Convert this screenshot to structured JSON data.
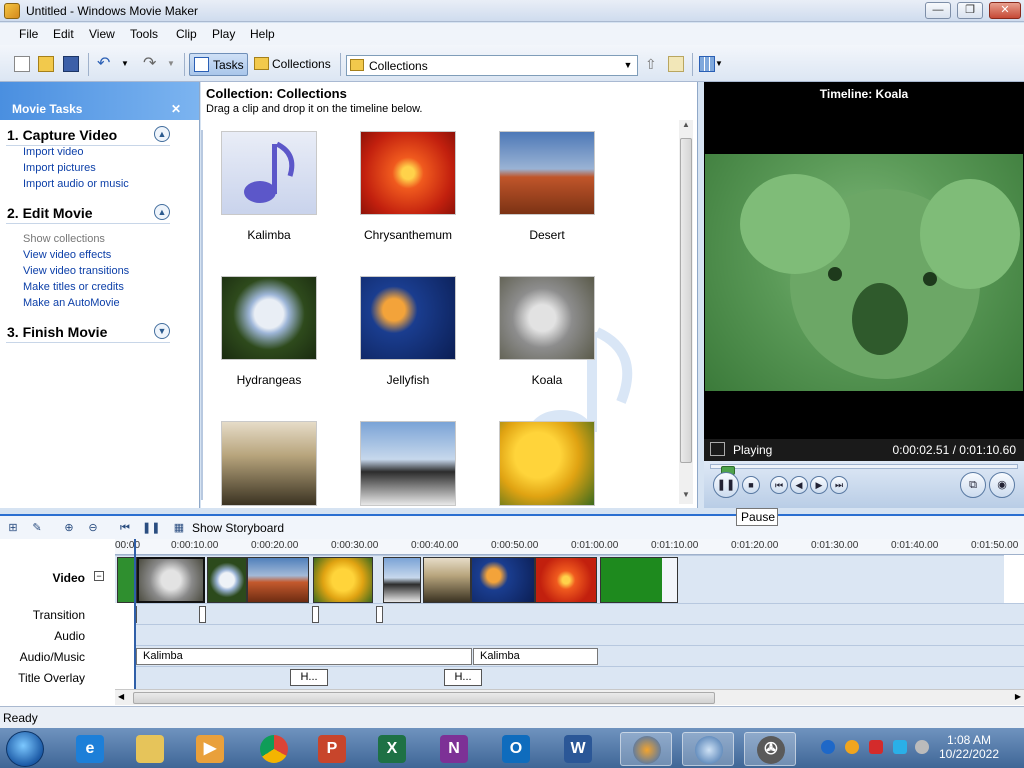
{
  "window": {
    "title": "Untitled - Windows Movie Maker"
  },
  "menu": [
    "File",
    "Edit",
    "View",
    "Tools",
    "Clip",
    "Play",
    "Help"
  ],
  "toolbar": {
    "tasks_label": "Tasks",
    "collections_label": "Collections",
    "collection_combo": "Collections"
  },
  "task_pane": {
    "header": "Movie Tasks",
    "sections": [
      {
        "title": "1. Capture Video",
        "links": [
          "Import video",
          "Import pictures",
          "Import audio or music"
        ]
      },
      {
        "title": "2. Edit Movie",
        "links": [
          "Show collections",
          "View video effects",
          "View video transitions",
          "Make titles or credits",
          "Make an AutoMovie"
        ]
      },
      {
        "title": "3. Finish Movie",
        "links": []
      }
    ]
  },
  "collection": {
    "title": "Collection: Collections",
    "subtitle": "Drag a clip and drop it on the timeline below.",
    "items": [
      "Kalimba",
      "Chrysanthemum",
      "Desert",
      "Hydrangeas",
      "Jellyfish",
      "Koala",
      "",
      "",
      ""
    ]
  },
  "monitor": {
    "title": "Timeline: Koala",
    "status": "Playing",
    "time": "0:00:02.51 / 0:01:10.60",
    "tooltip": "Pause",
    "progress_fraction": 0.036
  },
  "timeline_toolbar": {
    "storyboard_label": "Show Storyboard"
  },
  "timeline": {
    "ruler_ticks": [
      "00:00",
      "0:00:10.00",
      "0:00:20.00",
      "0:00:30.00",
      "0:00:40.00",
      "0:00:50.00",
      "0:01:00.00",
      "0:01:10.00",
      "0:01:20.00",
      "0:01:30.00",
      "0:01:40.00",
      "0:01:50.00"
    ],
    "track_labels": [
      "Video",
      "Transition",
      "Audio",
      "Audio/Music",
      "Title Overlay"
    ],
    "audio_clips": [
      "Kalimba",
      "Kalimba"
    ],
    "title_clips": [
      "H...",
      "H..."
    ]
  },
  "status_bar": {
    "text": "Ready"
  },
  "clock": {
    "time": "1:08 AM",
    "date": "10/22/2022"
  },
  "colors": {
    "accent": "#2b6fd1",
    "task_header": "#4a8fe0",
    "link": "#0c3fa8"
  }
}
